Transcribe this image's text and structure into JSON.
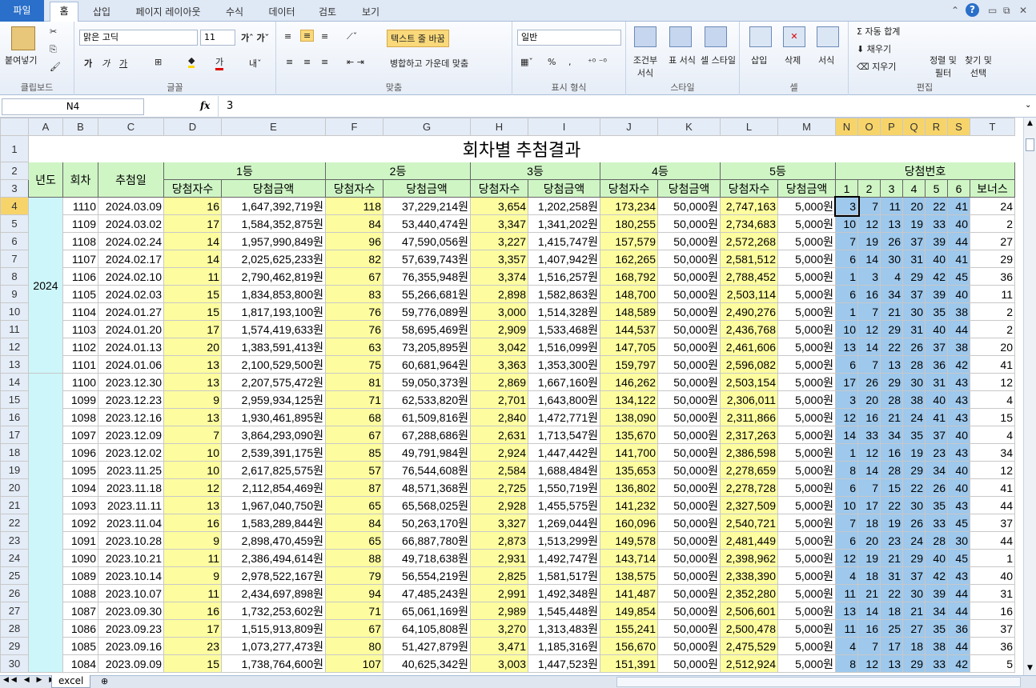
{
  "ribbon_tabs": [
    "파일",
    "홈",
    "삽입",
    "페이지 레이아웃",
    "수식",
    "데이터",
    "검토",
    "보기"
  ],
  "ribbon": {
    "paste": "붙여넣기",
    "clipboard": "클립보드",
    "font_name": "맑은 고딕",
    "font_size": "11",
    "font_group": "글꼴",
    "wrap_text": "텍스트 줄 바꿈",
    "merge_center": "병합하고 가운데 맞춤",
    "align_group": "맞춤",
    "number_format": "일반",
    "number_group": "표시 형식",
    "cond_format": "조건부 서식",
    "table_format": "표 서식",
    "cell_style": "셀 스타일",
    "style_group": "스타일",
    "insert": "삽입",
    "delete": "삭제",
    "format": "서식",
    "cells_group": "셀",
    "autosum": "자동 합계",
    "fill": "채우기",
    "clear": "지우기",
    "sort_filter": "정렬 및 필터",
    "find_select": "찾기 및 선택",
    "edit_group": "편집",
    "bold": "가",
    "italic": "가",
    "underline": "가",
    "percent": "%",
    "comma": ",",
    "fx": "fx"
  },
  "formula": {
    "cell_ref": "N4",
    "value": "3"
  },
  "columns": [
    "A",
    "B",
    "C",
    "D",
    "E",
    "F",
    "G",
    "H",
    "I",
    "J",
    "K",
    "L",
    "M",
    "N",
    "O",
    "P",
    "Q",
    "R",
    "S",
    "T"
  ],
  "sheet": {
    "title": "회차별 추첨결과",
    "year_label": "년도",
    "round_label": "회차",
    "date_label": "추첨일",
    "prize1": "1등",
    "prize2": "2등",
    "prize3": "3등",
    "prize4": "4등",
    "prize5": "5등",
    "numbers_label": "당첨번호",
    "winners": "당첨자수",
    "amount": "당첨금액",
    "bonus": "보너스",
    "num_headers": [
      "1",
      "2",
      "3",
      "4",
      "5",
      "6"
    ],
    "year2024": "2024"
  },
  "rows": [
    [
      "1110",
      "2024.03.09",
      "16",
      "1,647,392,719원",
      "118",
      "37,229,214원",
      "3,654",
      "1,202,258원",
      "173,234",
      "50,000원",
      "2,747,163",
      "5,000원",
      "3",
      "7",
      "11",
      "20",
      "22",
      "41",
      "24"
    ],
    [
      "1109",
      "2024.03.02",
      "17",
      "1,584,352,875원",
      "84",
      "53,440,474원",
      "3,347",
      "1,341,202원",
      "180,255",
      "50,000원",
      "2,734,683",
      "5,000원",
      "10",
      "12",
      "13",
      "19",
      "33",
      "40",
      "2"
    ],
    [
      "1108",
      "2024.02.24",
      "14",
      "1,957,990,849원",
      "96",
      "47,590,056원",
      "3,227",
      "1,415,747원",
      "157,579",
      "50,000원",
      "2,572,268",
      "5,000원",
      "7",
      "19",
      "26",
      "37",
      "39",
      "44",
      "27"
    ],
    [
      "1107",
      "2024.02.17",
      "14",
      "2,025,625,233원",
      "82",
      "57,639,743원",
      "3,357",
      "1,407,942원",
      "162,265",
      "50,000원",
      "2,581,512",
      "5,000원",
      "6",
      "14",
      "30",
      "31",
      "40",
      "41",
      "29"
    ],
    [
      "1106",
      "2024.02.10",
      "11",
      "2,790,462,819원",
      "67",
      "76,355,948원",
      "3,374",
      "1,516,257원",
      "168,792",
      "50,000원",
      "2,788,452",
      "5,000원",
      "1",
      "3",
      "4",
      "29",
      "42",
      "45",
      "36"
    ],
    [
      "1105",
      "2024.02.03",
      "15",
      "1,834,853,800원",
      "83",
      "55,266,681원",
      "2,898",
      "1,582,863원",
      "148,700",
      "50,000원",
      "2,503,114",
      "5,000원",
      "6",
      "16",
      "34",
      "37",
      "39",
      "40",
      "11"
    ],
    [
      "1104",
      "2024.01.27",
      "15",
      "1,817,193,100원",
      "76",
      "59,776,089원",
      "3,000",
      "1,514,328원",
      "148,589",
      "50,000원",
      "2,490,276",
      "5,000원",
      "1",
      "7",
      "21",
      "30",
      "35",
      "38",
      "2"
    ],
    [
      "1103",
      "2024.01.20",
      "17",
      "1,574,419,633원",
      "76",
      "58,695,469원",
      "2,909",
      "1,533,468원",
      "144,537",
      "50,000원",
      "2,436,768",
      "5,000원",
      "10",
      "12",
      "29",
      "31",
      "40",
      "44",
      "2"
    ],
    [
      "1102",
      "2024.01.13",
      "20",
      "1,383,591,413원",
      "63",
      "73,205,895원",
      "3,042",
      "1,516,099원",
      "147,705",
      "50,000원",
      "2,461,606",
      "5,000원",
      "13",
      "14",
      "22",
      "26",
      "37",
      "38",
      "20"
    ],
    [
      "1101",
      "2024.01.06",
      "13",
      "2,100,529,500원",
      "75",
      "60,681,964원",
      "3,363",
      "1,353,300원",
      "159,797",
      "50,000원",
      "2,596,082",
      "5,000원",
      "6",
      "7",
      "13",
      "28",
      "36",
      "42",
      "41"
    ],
    [
      "1100",
      "2023.12.30",
      "13",
      "2,207,575,472원",
      "81",
      "59,050,373원",
      "2,869",
      "1,667,160원",
      "146,262",
      "50,000원",
      "2,503,154",
      "5,000원",
      "17",
      "26",
      "29",
      "30",
      "31",
      "43",
      "12"
    ],
    [
      "1099",
      "2023.12.23",
      "9",
      "2,959,934,125원",
      "71",
      "62,533,820원",
      "2,701",
      "1,643,800원",
      "134,122",
      "50,000원",
      "2,306,011",
      "5,000원",
      "3",
      "20",
      "28",
      "38",
      "40",
      "43",
      "4"
    ],
    [
      "1098",
      "2023.12.16",
      "13",
      "1,930,461,895원",
      "68",
      "61,509,816원",
      "2,840",
      "1,472,771원",
      "138,090",
      "50,000원",
      "2,311,866",
      "5,000원",
      "12",
      "16",
      "21",
      "24",
      "41",
      "43",
      "15"
    ],
    [
      "1097",
      "2023.12.09",
      "7",
      "3,864,293,090원",
      "67",
      "67,288,686원",
      "2,631",
      "1,713,547원",
      "135,670",
      "50,000원",
      "2,317,263",
      "5,000원",
      "14",
      "33",
      "34",
      "35",
      "37",
      "40",
      "4"
    ],
    [
      "1096",
      "2023.12.02",
      "10",
      "2,539,391,175원",
      "85",
      "49,791,984원",
      "2,924",
      "1,447,442원",
      "141,700",
      "50,000원",
      "2,386,598",
      "5,000원",
      "1",
      "12",
      "16",
      "19",
      "23",
      "43",
      "34"
    ],
    [
      "1095",
      "2023.11.25",
      "10",
      "2,617,825,575원",
      "57",
      "76,544,608원",
      "2,584",
      "1,688,484원",
      "135,653",
      "50,000원",
      "2,278,659",
      "5,000원",
      "8",
      "14",
      "28",
      "29",
      "34",
      "40",
      "12"
    ],
    [
      "1094",
      "2023.11.18",
      "12",
      "2,112,854,469원",
      "87",
      "48,571,368원",
      "2,725",
      "1,550,719원",
      "136,802",
      "50,000원",
      "2,278,728",
      "5,000원",
      "6",
      "7",
      "15",
      "22",
      "26",
      "40",
      "41"
    ],
    [
      "1093",
      "2023.11.11",
      "13",
      "1,967,040,750원",
      "65",
      "65,568,025원",
      "2,928",
      "1,455,575원",
      "141,232",
      "50,000원",
      "2,327,509",
      "5,000원",
      "10",
      "17",
      "22",
      "30",
      "35",
      "43",
      "44"
    ],
    [
      "1092",
      "2023.11.04",
      "16",
      "1,583,289,844원",
      "84",
      "50,263,170원",
      "3,327",
      "1,269,044원",
      "160,096",
      "50,000원",
      "2,540,721",
      "5,000원",
      "7",
      "18",
      "19",
      "26",
      "33",
      "45",
      "37"
    ],
    [
      "1091",
      "2023.10.28",
      "9",
      "2,898,470,459원",
      "65",
      "66,887,780원",
      "2,873",
      "1,513,299원",
      "149,578",
      "50,000원",
      "2,481,449",
      "5,000원",
      "6",
      "20",
      "23",
      "24",
      "28",
      "30",
      "44"
    ],
    [
      "1090",
      "2023.10.21",
      "11",
      "2,386,494,614원",
      "88",
      "49,718,638원",
      "2,931",
      "1,492,747원",
      "143,714",
      "50,000원",
      "2,398,962",
      "5,000원",
      "12",
      "19",
      "21",
      "29",
      "40",
      "45",
      "1"
    ],
    [
      "1089",
      "2023.10.14",
      "9",
      "2,978,522,167원",
      "79",
      "56,554,219원",
      "2,825",
      "1,581,517원",
      "138,575",
      "50,000원",
      "2,338,390",
      "5,000원",
      "4",
      "18",
      "31",
      "37",
      "42",
      "43",
      "40"
    ],
    [
      "1088",
      "2023.10.07",
      "11",
      "2,434,697,898원",
      "94",
      "47,485,243원",
      "2,991",
      "1,492,348원",
      "141,487",
      "50,000원",
      "2,352,280",
      "5,000원",
      "11",
      "21",
      "22",
      "30",
      "39",
      "44",
      "31"
    ],
    [
      "1087",
      "2023.09.30",
      "16",
      "1,732,253,602원",
      "71",
      "65,061,169원",
      "2,989",
      "1,545,448원",
      "149,854",
      "50,000원",
      "2,506,601",
      "5,000원",
      "13",
      "14",
      "18",
      "21",
      "34",
      "44",
      "16"
    ],
    [
      "1086",
      "2023.09.23",
      "17",
      "1,515,913,809원",
      "67",
      "64,105,808원",
      "3,270",
      "1,313,483원",
      "155,241",
      "50,000원",
      "2,500,478",
      "5,000원",
      "11",
      "16",
      "25",
      "27",
      "35",
      "36",
      "37"
    ],
    [
      "1085",
      "2023.09.16",
      "23",
      "1,073,277,473원",
      "80",
      "51,427,879원",
      "3,471",
      "1,185,316원",
      "156,670",
      "50,000원",
      "2,475,529",
      "5,000원",
      "4",
      "7",
      "17",
      "18",
      "38",
      "44",
      "36"
    ],
    [
      "1084",
      "2023.09.09",
      "15",
      "1,738,764,600원",
      "107",
      "40,625,342원",
      "3,003",
      "1,447,523원",
      "151,391",
      "50,000원",
      "2,512,924",
      "5,000원",
      "8",
      "12",
      "13",
      "29",
      "33",
      "42",
      "5"
    ]
  ],
  "sheet_tab": "excel"
}
